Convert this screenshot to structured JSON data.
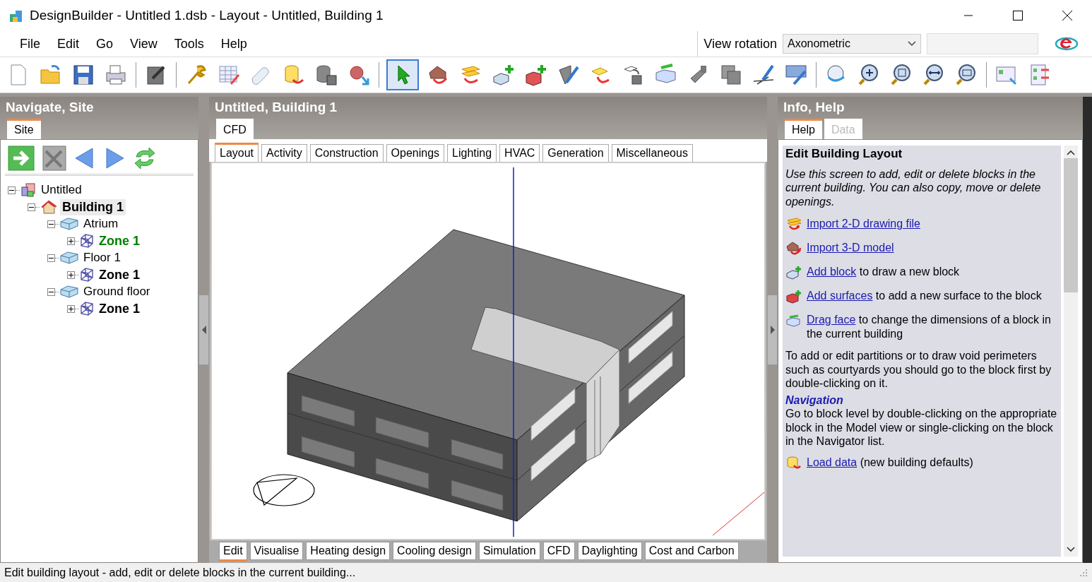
{
  "window": {
    "title": "DesignBuilder - Untitled 1.dsb - Layout - Untitled, Building 1"
  },
  "menu": [
    "File",
    "Edit",
    "Go",
    "View",
    "Tools",
    "Help"
  ],
  "view_rotation": {
    "label": "View rotation",
    "value": "Axonometric"
  },
  "left_panel": {
    "title": "Navigate, Site",
    "tabs": [
      {
        "label": "Site",
        "selected": true
      }
    ],
    "tree": [
      {
        "label": "Untitled",
        "kind": "site",
        "selected": false,
        "expanded": true,
        "children": [
          {
            "label": "Building 1",
            "kind": "building",
            "selected": true,
            "expanded": true,
            "children": [
              {
                "label": "Atrium",
                "kind": "block",
                "selected": false,
                "expanded": true,
                "children": [
                  {
                    "label": "Zone 1",
                    "kind": "zone",
                    "selected": false,
                    "expanded": false,
                    "color": "#008000"
                  }
                ]
              },
              {
                "label": "Floor 1",
                "kind": "block",
                "selected": false,
                "expanded": true,
                "children": [
                  {
                    "label": "Zone 1",
                    "kind": "zone",
                    "selected": false,
                    "expanded": false,
                    "color": "#000000"
                  }
                ]
              },
              {
                "label": "Ground floor",
                "kind": "block",
                "selected": false,
                "expanded": true,
                "children": [
                  {
                    "label": "Zone 1",
                    "kind": "zone",
                    "selected": false,
                    "expanded": false,
                    "color": "#000000"
                  }
                ]
              }
            ]
          }
        ]
      }
    ]
  },
  "center_panel": {
    "title": "Untitled, Building 1",
    "top_tabs": [
      {
        "label": "CFD",
        "selected": false
      }
    ],
    "tabs": [
      {
        "label": "Layout",
        "selected": true
      },
      {
        "label": "Activity",
        "selected": false
      },
      {
        "label": "Construction",
        "selected": false
      },
      {
        "label": "Openings",
        "selected": false
      },
      {
        "label": "Lighting",
        "selected": false
      },
      {
        "label": "HVAC",
        "selected": false
      },
      {
        "label": "Generation",
        "selected": false
      },
      {
        "label": "Miscellaneous",
        "selected": false
      }
    ],
    "bottom_tabs": [
      {
        "label": "Edit",
        "selected": true
      },
      {
        "label": "Visualise",
        "selected": false
      },
      {
        "label": "Heating design",
        "selected": false
      },
      {
        "label": "Cooling design",
        "selected": false
      },
      {
        "label": "Simulation",
        "selected": false
      },
      {
        "label": "CFD",
        "selected": false
      },
      {
        "label": "Daylighting",
        "selected": false
      },
      {
        "label": "Cost and Carbon",
        "selected": false
      }
    ]
  },
  "right_panel": {
    "title": "Info, Help",
    "tabs": [
      {
        "label": "Help",
        "selected": true,
        "disabled": false
      },
      {
        "label": "Data",
        "selected": false,
        "disabled": true
      }
    ],
    "heading": "Edit Building Layout",
    "intro": "Use this screen to add, edit or delete blocks in the current building. You can also copy, move or delete openings.",
    "items": [
      {
        "kind": "import2d",
        "link": "Import 2-D drawing file"
      },
      {
        "kind": "import3d",
        "link": "Import 3-D model"
      },
      {
        "kind": "addblock",
        "link": "Add block",
        "text": "to draw a new block"
      },
      {
        "kind": "addsurface",
        "link": "Add surfaces",
        "text": "to add a new surface to the block"
      },
      {
        "kind": "dragface",
        "link": "Drag face",
        "text": "to change the dimensions of a block in the current building"
      }
    ],
    "partitions_text": "To add or edit partitions or to draw void perimeters such as courtyards you should go to the block first by double-clicking on it.",
    "navigation_heading": "Navigation",
    "navigation_text": "Go to block level by double-clicking on the appropriate block in the Model view or single-clicking on the block in the Navigator list.",
    "load": {
      "kind": "load",
      "link": "Load data",
      "text": "(new building defaults)"
    }
  },
  "status_bar": "Edit building layout - add, edit or delete blocks in the current building..."
}
